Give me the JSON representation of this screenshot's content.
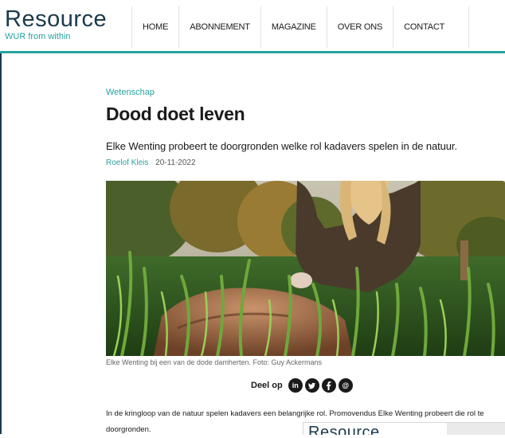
{
  "header": {
    "logo": "Resource",
    "tagline": "WUR from within",
    "nav": [
      "HOME",
      "ABONNEMENT",
      "MAGAZINE",
      "OVER ONS",
      "CONTACT"
    ]
  },
  "article": {
    "category": "Wetenschap",
    "title": "Dood doet leven",
    "intro": "Elke Wenting probeert te doorgronden welke rol kadavers spelen in de natuur.",
    "author": "Roelof Kleis",
    "date": "20-11-2022",
    "photo_caption": "Elke Wenting bij een van de dode damherten. Foto: Guy Ackermans",
    "body_line1": "In de kringloop van de natuur spelen kadavers een belangrijke rol. Promovendus Elke Wenting probeert die rol te",
    "body_line2": "doorgronden."
  },
  "share": {
    "label": "Deel op",
    "icons": [
      "linkedin-icon",
      "twitter-icon",
      "facebook-icon",
      "email-icon"
    ]
  },
  "overlay": {
    "logo": "Resource"
  },
  "colors": {
    "accent": "#27a3a0",
    "brand": "#1b3a4b"
  }
}
